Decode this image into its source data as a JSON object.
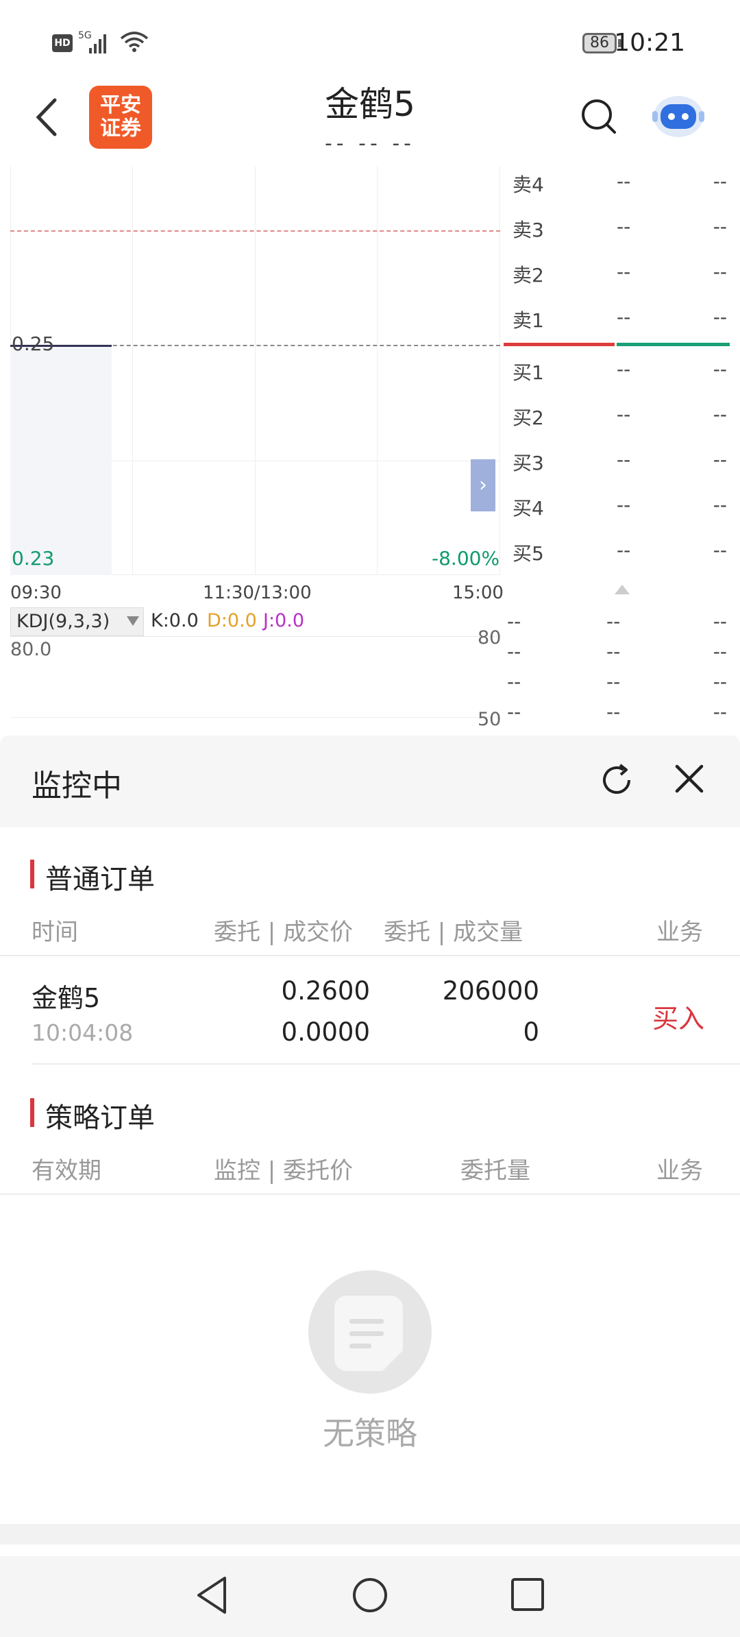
{
  "status_bar": {
    "hd": "HD",
    "net": "5G",
    "battery": "86",
    "time": "10:21"
  },
  "header": {
    "logo_line1": "平安",
    "logo_line2": "证券",
    "title": "金鹤5",
    "subtitle": "-- -- --"
  },
  "chart": {
    "price_ref": "0.25",
    "price_low": "0.23",
    "change_pct": "-8.00%",
    "time_start": "09:30",
    "time_mid": "11:30/13:00",
    "time_end": "15:00",
    "expand_arrow": "›"
  },
  "order_book": {
    "sells": [
      {
        "name": "卖4",
        "price": "--",
        "vol": "--"
      },
      {
        "name": "卖3",
        "price": "--",
        "vol": "--"
      },
      {
        "name": "卖2",
        "price": "--",
        "vol": "--"
      },
      {
        "name": "卖1",
        "price": "--",
        "vol": "--"
      }
    ],
    "buys": [
      {
        "name": "买1",
        "price": "--",
        "vol": "--"
      },
      {
        "name": "买2",
        "price": "--",
        "vol": "--"
      },
      {
        "name": "买3",
        "price": "--",
        "vol": "--"
      },
      {
        "name": "买4",
        "price": "--",
        "vol": "--"
      },
      {
        "name": "买5",
        "price": "--",
        "vol": "--"
      }
    ],
    "trades": [
      {
        "a": "--",
        "b": "--",
        "c": "--"
      },
      {
        "a": "--",
        "b": "--",
        "c": "--"
      },
      {
        "a": "--",
        "b": "--",
        "c": "--"
      },
      {
        "a": "--",
        "b": "--",
        "c": "--"
      }
    ]
  },
  "kdj": {
    "selector": "KDJ(9,3,3)",
    "k": "K:0.0",
    "d": "D:0.0",
    "j": "J:0.0",
    "level_80": "80.0",
    "level_80_right": "80",
    "level_50": "50"
  },
  "panel": {
    "title": "监控中",
    "normal_section": "普通订单",
    "normal_cols": {
      "time": "时间",
      "price": "委托 | 成交价",
      "qty": "委托 | 成交量",
      "biz": "业务"
    },
    "order": {
      "name": "金鹤5",
      "time": "10:04:08",
      "entrust_price": "0.2600",
      "deal_price": "0.0000",
      "entrust_qty": "206000",
      "deal_qty": "0",
      "action": "买入"
    },
    "strategy_section": "策略订单",
    "strategy_cols": {
      "valid": "有效期",
      "price": "监控 | 委托价",
      "qty": "委托量",
      "biz": "业务"
    },
    "empty_text": "无策略"
  },
  "colors": {
    "accent_red": "#d9363e",
    "up_green": "#19a077",
    "brand_orange": "#f05a28"
  }
}
